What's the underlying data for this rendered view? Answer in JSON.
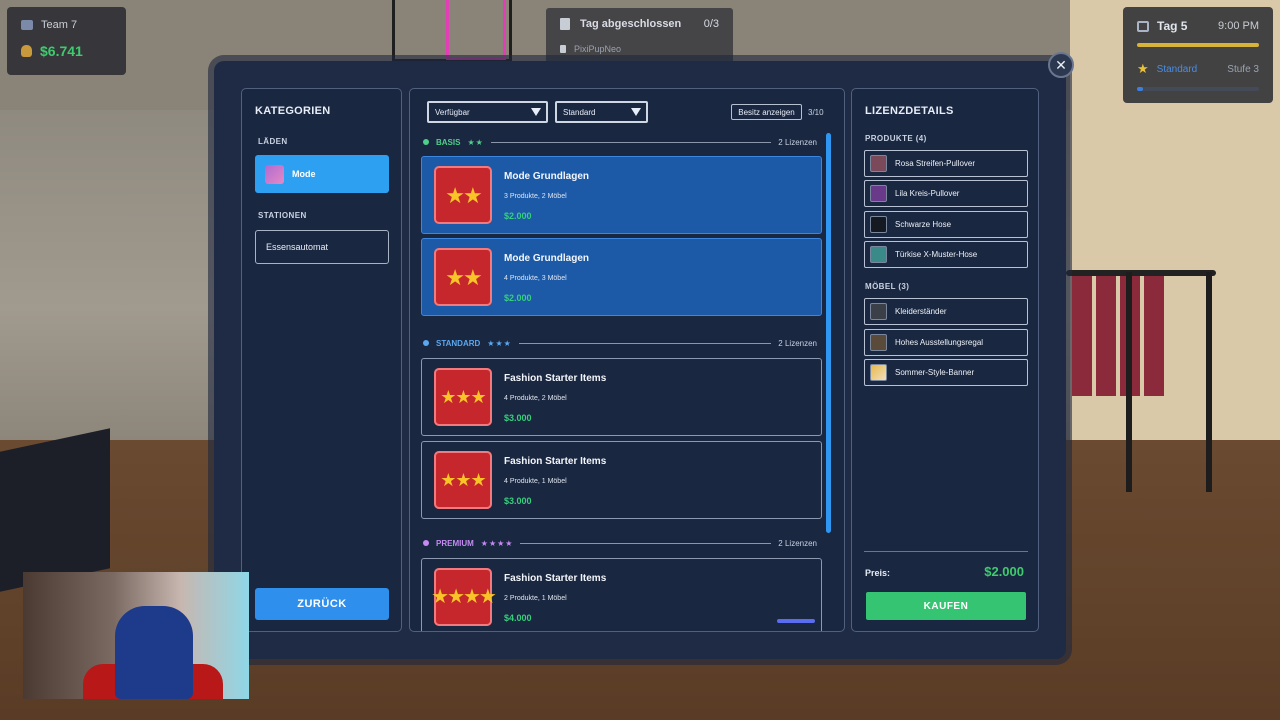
{
  "hud": {
    "team_name": "Team 7",
    "money": "$6.741",
    "task_title": "Tag abgeschlossen",
    "task_count": "0/3",
    "task_sub": "PixiPupNeo",
    "day": "Tag 5",
    "time": "9:00 PM",
    "level_name": "Standard",
    "level_stage": "Stufe 3",
    "level_progress": 0.05
  },
  "categories": {
    "title": "KATEGORIEN",
    "shops_label": "LÄDEN",
    "shop_item": "Mode",
    "stations_label": "STATIONEN",
    "station_item": "Essensautomat",
    "back_label": "ZURÜCK"
  },
  "licenses": {
    "filter_availability": "Verfügbar",
    "filter_sort": "Standard",
    "owned_button": "Besitz anzeigen",
    "count": "3/10",
    "tiers": [
      {
        "name": "BASIS",
        "stars": "★★",
        "count": "2 Lizenzen",
        "color": "#4fd08a"
      },
      {
        "name": "STANDARD",
        "stars": "★★★",
        "count": "2 Lizenzen",
        "color": "#5aa8f0"
      },
      {
        "name": "PREMIUM",
        "stars": "★★★★",
        "count": "2 Lizenzen",
        "color": "#c58af2"
      }
    ],
    "cards": [
      {
        "name": "Mode Grundlagen",
        "desc": "3 Produkte, 2 Möbel",
        "price": "$2.000",
        "stars": "★★"
      },
      {
        "name": "Mode Grundlagen",
        "desc": "4 Produkte, 3 Möbel",
        "price": "$2.000",
        "stars": "★★"
      },
      {
        "name": "Fashion Starter Items",
        "desc": "4 Produkte, 2 Möbel",
        "price": "$3.000",
        "stars": "★★★"
      },
      {
        "name": "Fashion Starter Items",
        "desc": "4 Produkte, 1 Möbel",
        "price": "$3.000",
        "stars": "★★★"
      },
      {
        "name": "Fashion Starter Items",
        "desc": "2 Produkte, 1 Möbel",
        "price": "$4.000",
        "stars": "★★★★"
      }
    ]
  },
  "details": {
    "title": "LIZENZDETAILS",
    "products_label": "PRODUKTE (4)",
    "products": [
      "Rosa Streifen-Pullover",
      "Lila Kreis-Pullover",
      "Schwarze Hose",
      "Türkise X-Muster-Hose"
    ],
    "furniture_label": "MÖBEL (3)",
    "furniture": [
      "Kleiderständer",
      "Hohes Ausstellungsregal",
      "Sommer-Style-Banner"
    ],
    "price_label": "Preis:",
    "price_value": "$2.000",
    "buy_label": "KAUFEN"
  },
  "close_glyph": "✕"
}
